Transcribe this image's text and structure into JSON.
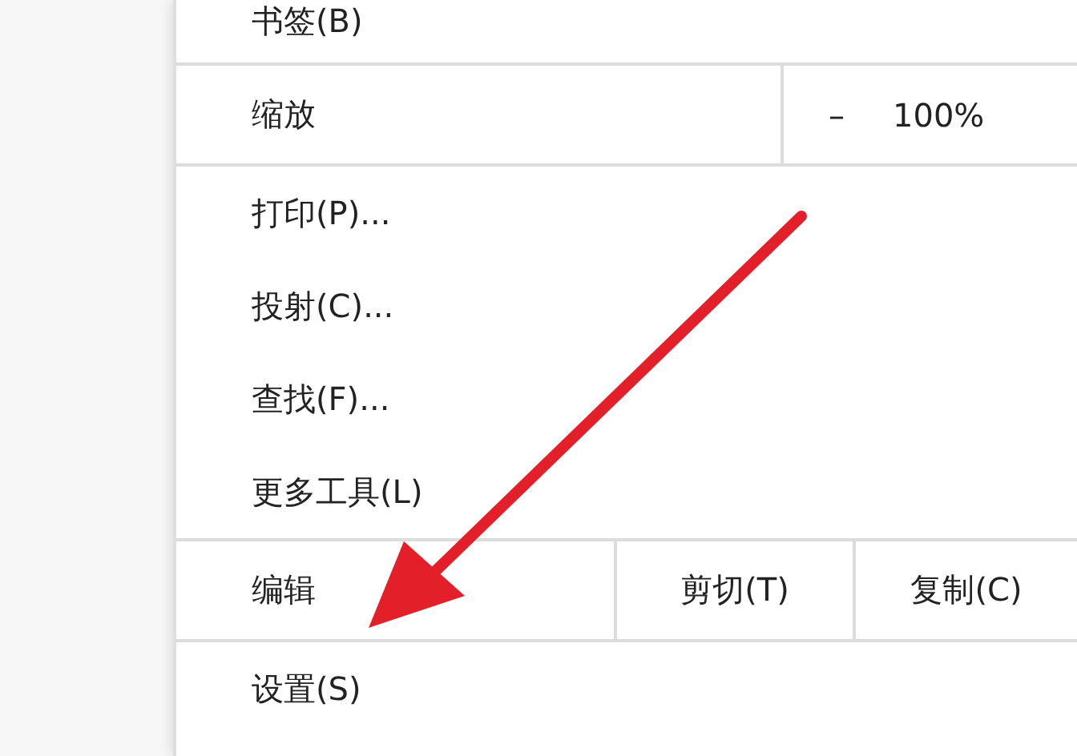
{
  "menu": {
    "items": [
      {
        "kind": "item",
        "label": "书签(B)"
      },
      {
        "kind": "zoom",
        "label": "缩放",
        "controls": [
          "–",
          "100%"
        ]
      },
      {
        "kind": "item",
        "label": "打印(P)..."
      },
      {
        "kind": "item",
        "label": "投射(C)..."
      },
      {
        "kind": "item",
        "label": "查找(F)..."
      },
      {
        "kind": "item",
        "label": "更多工具(L)"
      },
      {
        "kind": "edit",
        "label": "编辑",
        "controls": [
          "剪切(T)",
          "复制(C)"
        ]
      },
      {
        "kind": "item",
        "label": "设置(S)"
      }
    ]
  },
  "annotations": [
    {
      "kind": "arrow",
      "color": "#e3202a"
    }
  ]
}
